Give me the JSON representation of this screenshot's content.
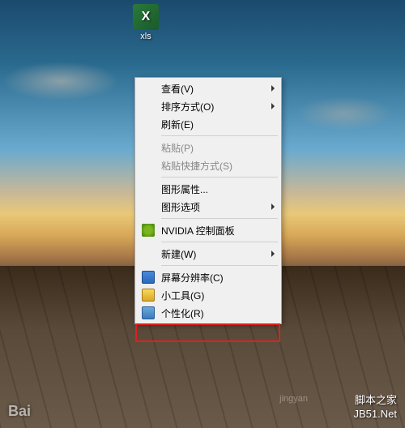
{
  "desktop": {
    "icon_label": "xls"
  },
  "context_menu": {
    "view": "查看(V)",
    "sort": "排序方式(O)",
    "refresh": "刷新(E)",
    "paste": "粘贴(P)",
    "paste_shortcut": "粘贴快捷方式(S)",
    "graphics_props": "图形属性...",
    "graphics_options": "图形选项",
    "nvidia": "NVIDIA 控制面板",
    "new": "新建(W)",
    "screen_res": "屏幕分辨率(C)",
    "gadgets": "小工具(G)",
    "personalize": "个性化(R)"
  },
  "watermarks": {
    "baidu": "Bai",
    "site_name": "脚本之家",
    "site_url_display": "JB51.Net",
    "jingyan": "jingyan"
  }
}
